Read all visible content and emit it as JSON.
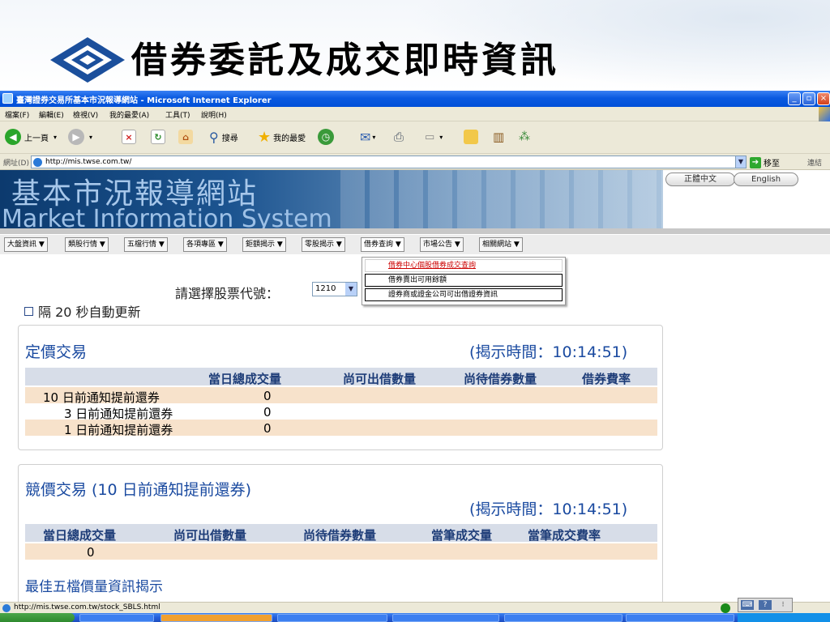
{
  "slide": {
    "title": "借券委託及成交即時資訊"
  },
  "window": {
    "title": "臺灣證券交易所基本市況報導網站 - Microsoft Internet Explorer",
    "menu": [
      "檔案(F)",
      "編輯(E)",
      "檢視(V)",
      "我的最愛(A)",
      "工具(T)",
      "說明(H)"
    ],
    "toolbar": {
      "back": "上一頁",
      "search": "搜尋",
      "favorites": "我的最愛"
    },
    "address": {
      "label": "網址(D)",
      "url": "http://mis.twse.com.tw/",
      "go": "移至",
      "links": "連結"
    }
  },
  "site": {
    "banner_zh": "基本市況報導網站",
    "banner_en": "Market Information System",
    "lang": [
      "正體中文",
      "English"
    ],
    "nav": [
      "大盤資訊 ▼",
      "類股行情 ▼",
      "五檔行情 ▼",
      "各項專區 ▼",
      "鉅額揭示 ▼",
      "零股揭示 ▼",
      "借券查詢 ▼",
      "市場公告 ▼",
      "相關網站 ▼"
    ],
    "dropdown": [
      "借券中心個股借券成交查詢",
      "借券賣出可用餘額",
      "證券商或證金公司可出借證券資訊"
    ]
  },
  "stock": {
    "label": "請選擇股票代號：",
    "value": "1210"
  },
  "refresh": {
    "label": "隔 20 秒自動更新"
  },
  "fixed": {
    "title": "定價交易",
    "time": "(揭示時間：10:14:51)",
    "headers": [
      "當日總成交量",
      "尚可出借數量",
      "尚待借券數量",
      "借券費率"
    ],
    "rows": [
      {
        "label": "10 日前通知提前還券",
        "vol": "0"
      },
      {
        "label": "3 日前通知提前還券",
        "vol": "0"
      },
      {
        "label": "1 日前通知提前還券",
        "vol": "0"
      }
    ]
  },
  "auction": {
    "title": "競價交易 (10 日前通知提前還券)",
    "time": "(揭示時間：10:14:51)",
    "headers": [
      "當日總成交量",
      "尚可出借數量",
      "尚待借券數量",
      "當筆成交量",
      "當筆成交費率"
    ],
    "row": [
      "0"
    ],
    "best5": "最佳五檔價量資訊揭示"
  },
  "status": {
    "url": "http://mis.twse.com.tw/stock_SBLS.html"
  },
  "colors": {
    "accent": "#1a4aa0",
    "tan": "#f7e2cb",
    "header": "#d7dde8",
    "xp_blue": "#0a5ae0"
  }
}
